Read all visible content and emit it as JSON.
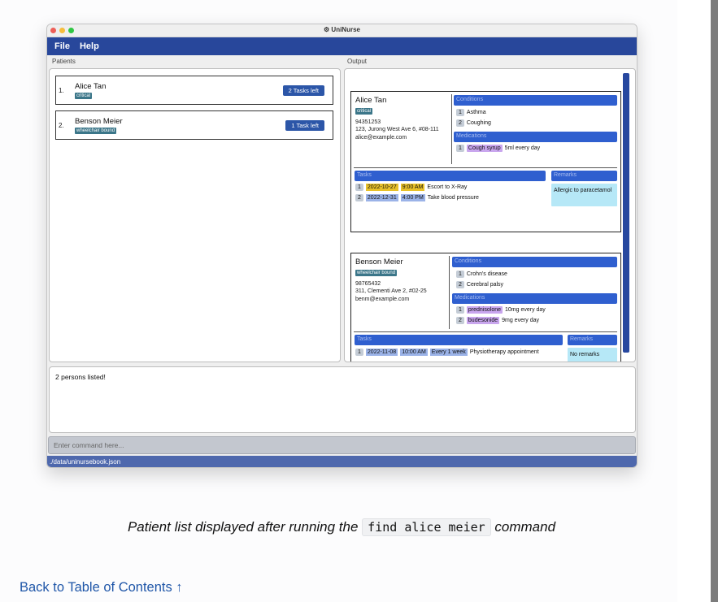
{
  "app": {
    "title": "UniNurse",
    "title_icon": "gear-icon"
  },
  "window_colors": {
    "close": "#ee5f58",
    "minimize": "#f6bd3c",
    "maximize": "#2fc643",
    "accent": "#28479b"
  },
  "menu": {
    "file": "File",
    "help": "Help"
  },
  "panes": {
    "patients_label": "Patients",
    "output_label": "Output"
  },
  "patients": [
    {
      "index": "1.",
      "name": "Alice Tan",
      "tag": "critical",
      "tasks_button": "2 Tasks left"
    },
    {
      "index": "2.",
      "name": "Benson Meier",
      "tag": "wheelchair bound",
      "tasks_button": "1 Task left"
    }
  ],
  "output": {
    "alice": {
      "name": "Alice Tan",
      "tag": "critical",
      "phone": "94351253",
      "address": "123, Jurong West Ave 6, #08-111",
      "email": "alice@example.com",
      "conditions_header": "Conditions",
      "conditions": [
        {
          "n": "1",
          "text": "Asthma"
        },
        {
          "n": "2",
          "text": "Coughing"
        }
      ],
      "medications_header": "Medications",
      "medications": [
        {
          "n": "1",
          "name": "Cough syrup",
          "dose": "5ml every day"
        }
      ],
      "tasks_header": "Tasks",
      "tasks": [
        {
          "n": "1",
          "date": "2022-10-27",
          "time": "9:00 AM",
          "desc": "Escort to X-Ray"
        },
        {
          "n": "2",
          "date": "2022-12-31",
          "time": "4:00 PM",
          "desc": "Take blood pressure"
        }
      ],
      "remarks_header": "Remarks",
      "remarks": "Allergic to paracetamol"
    },
    "benson": {
      "name": "Benson Meier",
      "tag": "wheelchair bound",
      "phone": "98765432",
      "address": "311, Clementi Ave 2, #02-25",
      "email": "benm@example.com",
      "conditions_header": "Conditions",
      "conditions": [
        {
          "n": "1",
          "text": "Crohn's disease"
        },
        {
          "n": "2",
          "text": "Cerebral palsy"
        }
      ],
      "medications_header": "Medications",
      "medications": [
        {
          "n": "1",
          "name": "prednisolone",
          "dose": "10mg every day"
        },
        {
          "n": "2",
          "name": "budesonide",
          "dose": "9mg every day"
        }
      ],
      "tasks_header": "Tasks",
      "tasks": [
        {
          "n": "1",
          "date": "2022-11-08",
          "time": "10:00 AM",
          "freq": "Every 1 week",
          "desc": "Physiotherapy appointment"
        }
      ],
      "remarks_header": "Remarks",
      "remarks": "No remarks"
    }
  },
  "result": "2 persons listed!",
  "command": {
    "placeholder": "Enter command here..."
  },
  "status": {
    "path": "./data/uninursebook.json"
  },
  "caption": {
    "before": "Patient list displayed after running the ",
    "code": "find alice meier",
    "after": " command"
  },
  "back_link": "Back to Table of Contents ↑"
}
